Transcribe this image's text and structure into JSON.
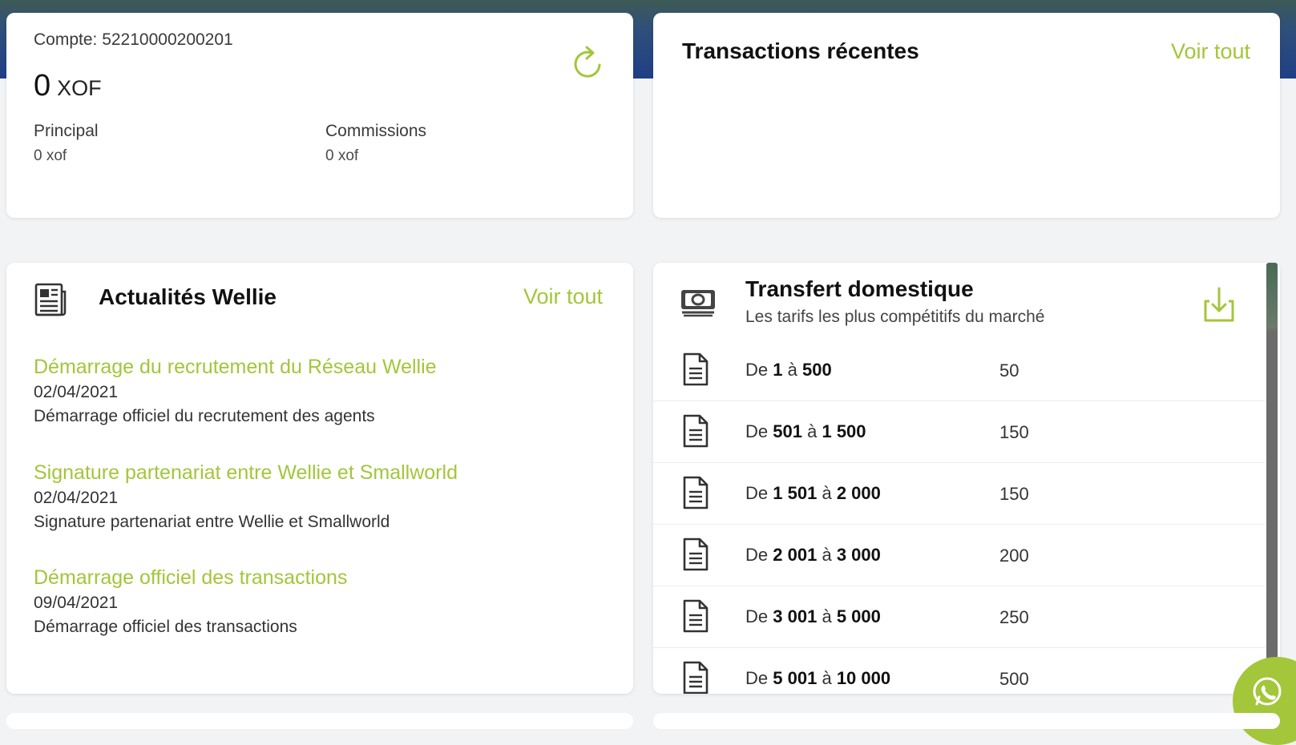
{
  "account": {
    "label": "Compte: 52210000200201",
    "balance": "0",
    "currency": "XOF",
    "principal_label": "Principal",
    "principal_value": "0 xof",
    "commissions_label": "Commissions",
    "commissions_value": "0 xof"
  },
  "transactions": {
    "title": "Transactions récentes",
    "see_all": "Voir tout"
  },
  "news": {
    "title": "Actualités Wellie",
    "see_all": "Voir tout",
    "items": [
      {
        "title": "Démarrage du recrutement du Réseau Wellie",
        "date": "02/04/2021",
        "desc": "Démarrage officiel du recrutement des agents"
      },
      {
        "title": "Signature partenariat entre Wellie et Smallworld",
        "date": "02/04/2021",
        "desc": "Signature partenariat entre Wellie et Smallworld"
      },
      {
        "title": "Démarrage officiel des transactions",
        "date": "09/04/2021",
        "desc": "Démarrage officiel des transactions"
      }
    ]
  },
  "transfer": {
    "title": "Transfert domestique",
    "subtitle": "Les tarifs les plus compétitifs du marché",
    "rows": [
      {
        "prefix": "De",
        "from": "1",
        "sep": "à",
        "to": "500",
        "price": "50"
      },
      {
        "prefix": "De",
        "from": "501",
        "sep": "à",
        "to": "1 500",
        "price": "150"
      },
      {
        "prefix": "De",
        "from": "1 501",
        "sep": "à",
        "to": "2 000",
        "price": "150"
      },
      {
        "prefix": "De",
        "from": "2 001",
        "sep": "à",
        "to": "3 000",
        "price": "200"
      },
      {
        "prefix": "De",
        "from": "3 001",
        "sep": "à",
        "to": "5 000",
        "price": "250"
      },
      {
        "prefix": "De",
        "from": "5 001",
        "sep": "à",
        "to": "10 000",
        "price": "500"
      }
    ]
  },
  "icons": {
    "refresh": "refresh-icon",
    "news": "newspaper-icon",
    "transfer": "money-icon",
    "download": "download-icon",
    "document": "document-icon",
    "whatsapp": "whatsapp-icon"
  },
  "colors": {
    "accent": "#a3c63a",
    "header_top": "#3e5a55",
    "header_bottom": "#1f3f86"
  }
}
